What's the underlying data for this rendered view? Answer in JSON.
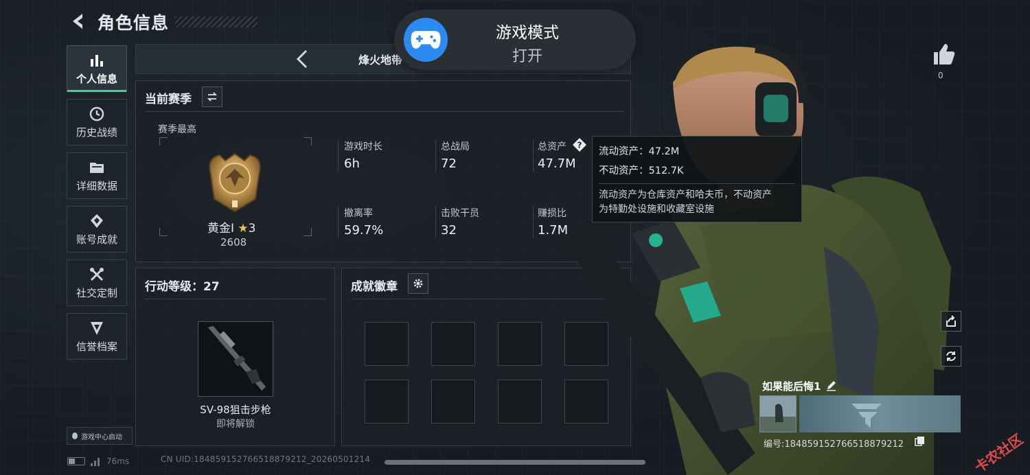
{
  "header": {
    "title": "角色信息"
  },
  "nav": {
    "items": [
      {
        "label": "个人信息",
        "icon": "bar-chart-icon",
        "active": true
      },
      {
        "label": "历史战绩",
        "icon": "history-icon",
        "active": false
      },
      {
        "label": "详细数据",
        "icon": "folder-icon",
        "active": false
      },
      {
        "label": "账号成就",
        "icon": "achievement-icon",
        "active": false
      },
      {
        "label": "社交定制",
        "icon": "tools-icon",
        "active": false
      },
      {
        "label": "信誉档案",
        "icon": "shield-icon",
        "active": false
      }
    ]
  },
  "launch_badge": "游戏中心启动",
  "status": {
    "ping": "76ms",
    "uid_line": "CN UID:184859152766518879212_2026050121​4"
  },
  "mode": {
    "title": "烽火地带"
  },
  "season": {
    "heading": "当前赛季",
    "best_label": "赛季最高",
    "rank_name": "黄金I",
    "rank_stars": "3",
    "rank_score": "2608",
    "stats": [
      {
        "label": "游戏时长",
        "value": "6h"
      },
      {
        "label": "总战局",
        "value": "72"
      },
      {
        "label": "总资产",
        "value": "47.7M"
      },
      {
        "label": "撤离率",
        "value": "59.7%"
      },
      {
        "label": "击败干员",
        "value": "32"
      },
      {
        "label": "赚损比",
        "value": "1.7M"
      }
    ]
  },
  "tooltip": {
    "liquid": "流动资产：47.2M",
    "fixed": "不动资产：512.7K",
    "desc1": "流动资产为仓库资产和哈夫币，不动资产",
    "desc2": "为特勤处设施和收藏室设施"
  },
  "level": {
    "heading": "行动等级：27",
    "weapon_name": "SV-98狙击步枪",
    "weapon_status": "即将解锁"
  },
  "badges": {
    "heading": "成就徽章"
  },
  "toast": {
    "title": "游戏模式",
    "subtitle": "打开"
  },
  "likes": {
    "count": "0"
  },
  "card": {
    "name": "如果能后悔1",
    "id": "编号:184859152766518879212"
  },
  "colors": {
    "accent": "#3fd29b",
    "toast_icon": "#2b8bf2",
    "star": "#f2c14e"
  }
}
